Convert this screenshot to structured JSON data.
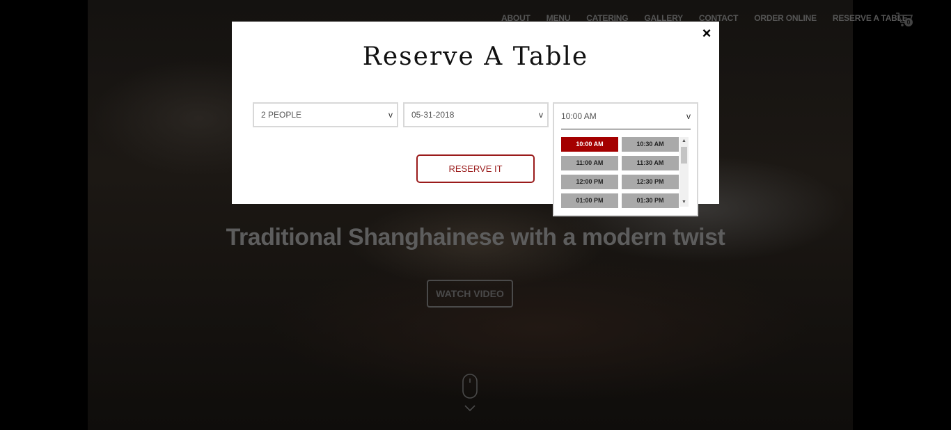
{
  "nav": {
    "items": [
      "ABOUT",
      "MENU",
      "CATERING",
      "GALLERY",
      "CONTACT",
      "ORDER ONLINE",
      "RESERVE A TABLE"
    ],
    "cart_count": "0"
  },
  "hero": {
    "tagline": "Traditional Shanghainese with a modern twist",
    "watch_video": "WATCH VIDEO"
  },
  "modal": {
    "title": "Reserve A Table",
    "close": "×",
    "party_size": "2 PEOPLE",
    "date": "05-31-2018",
    "time": "10:00 AM",
    "reserve_button": "RESERVE IT",
    "time_options": [
      "10:00 AM",
      "10:30 AM",
      "11:00 AM",
      "11:30 AM",
      "12:00 PM",
      "12:30 PM",
      "01:00 PM",
      "01:30 PM"
    ],
    "selected_time_index": 0
  },
  "colors": {
    "accent": "#a40000",
    "slot_bg": "#a9a9a9"
  }
}
